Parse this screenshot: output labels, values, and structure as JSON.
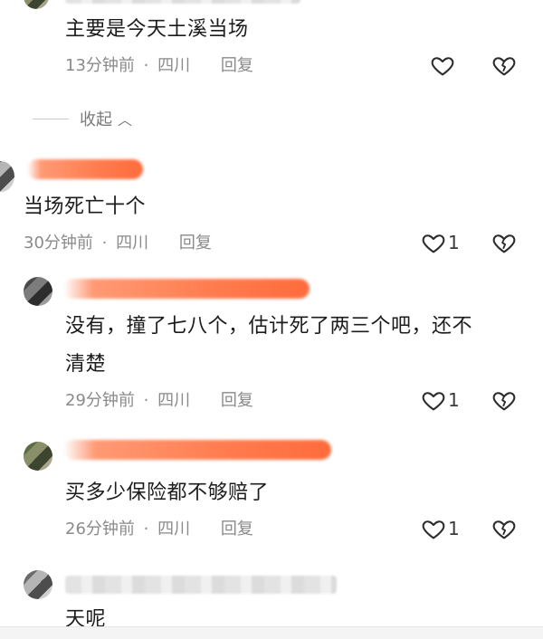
{
  "comments": [
    {
      "text": "主要是今天土溪当场",
      "time": "13分钟前",
      "location": "四川",
      "reply_label": "回复",
      "likes": ""
    },
    {
      "text": "当场死亡十个",
      "time": "30分钟前",
      "location": "四川",
      "reply_label": "回复",
      "likes": "1"
    },
    {
      "text_line1": "没有，撞了七八个，估计死了两三个吧，还不",
      "text_line2": "清楚",
      "time": "29分钟前",
      "location": "四川",
      "reply_label": "回复",
      "likes": "1"
    },
    {
      "text": "买多少保险都不够赔了",
      "time": "26分钟前",
      "location": "四川",
      "reply_label": "回复",
      "likes": "1"
    },
    {
      "text": "天呢"
    }
  ],
  "collapse_label": "收起",
  "separator": "·",
  "colors": {
    "meta": "#8a8a8a",
    "redaction": "#ff6e3c"
  }
}
